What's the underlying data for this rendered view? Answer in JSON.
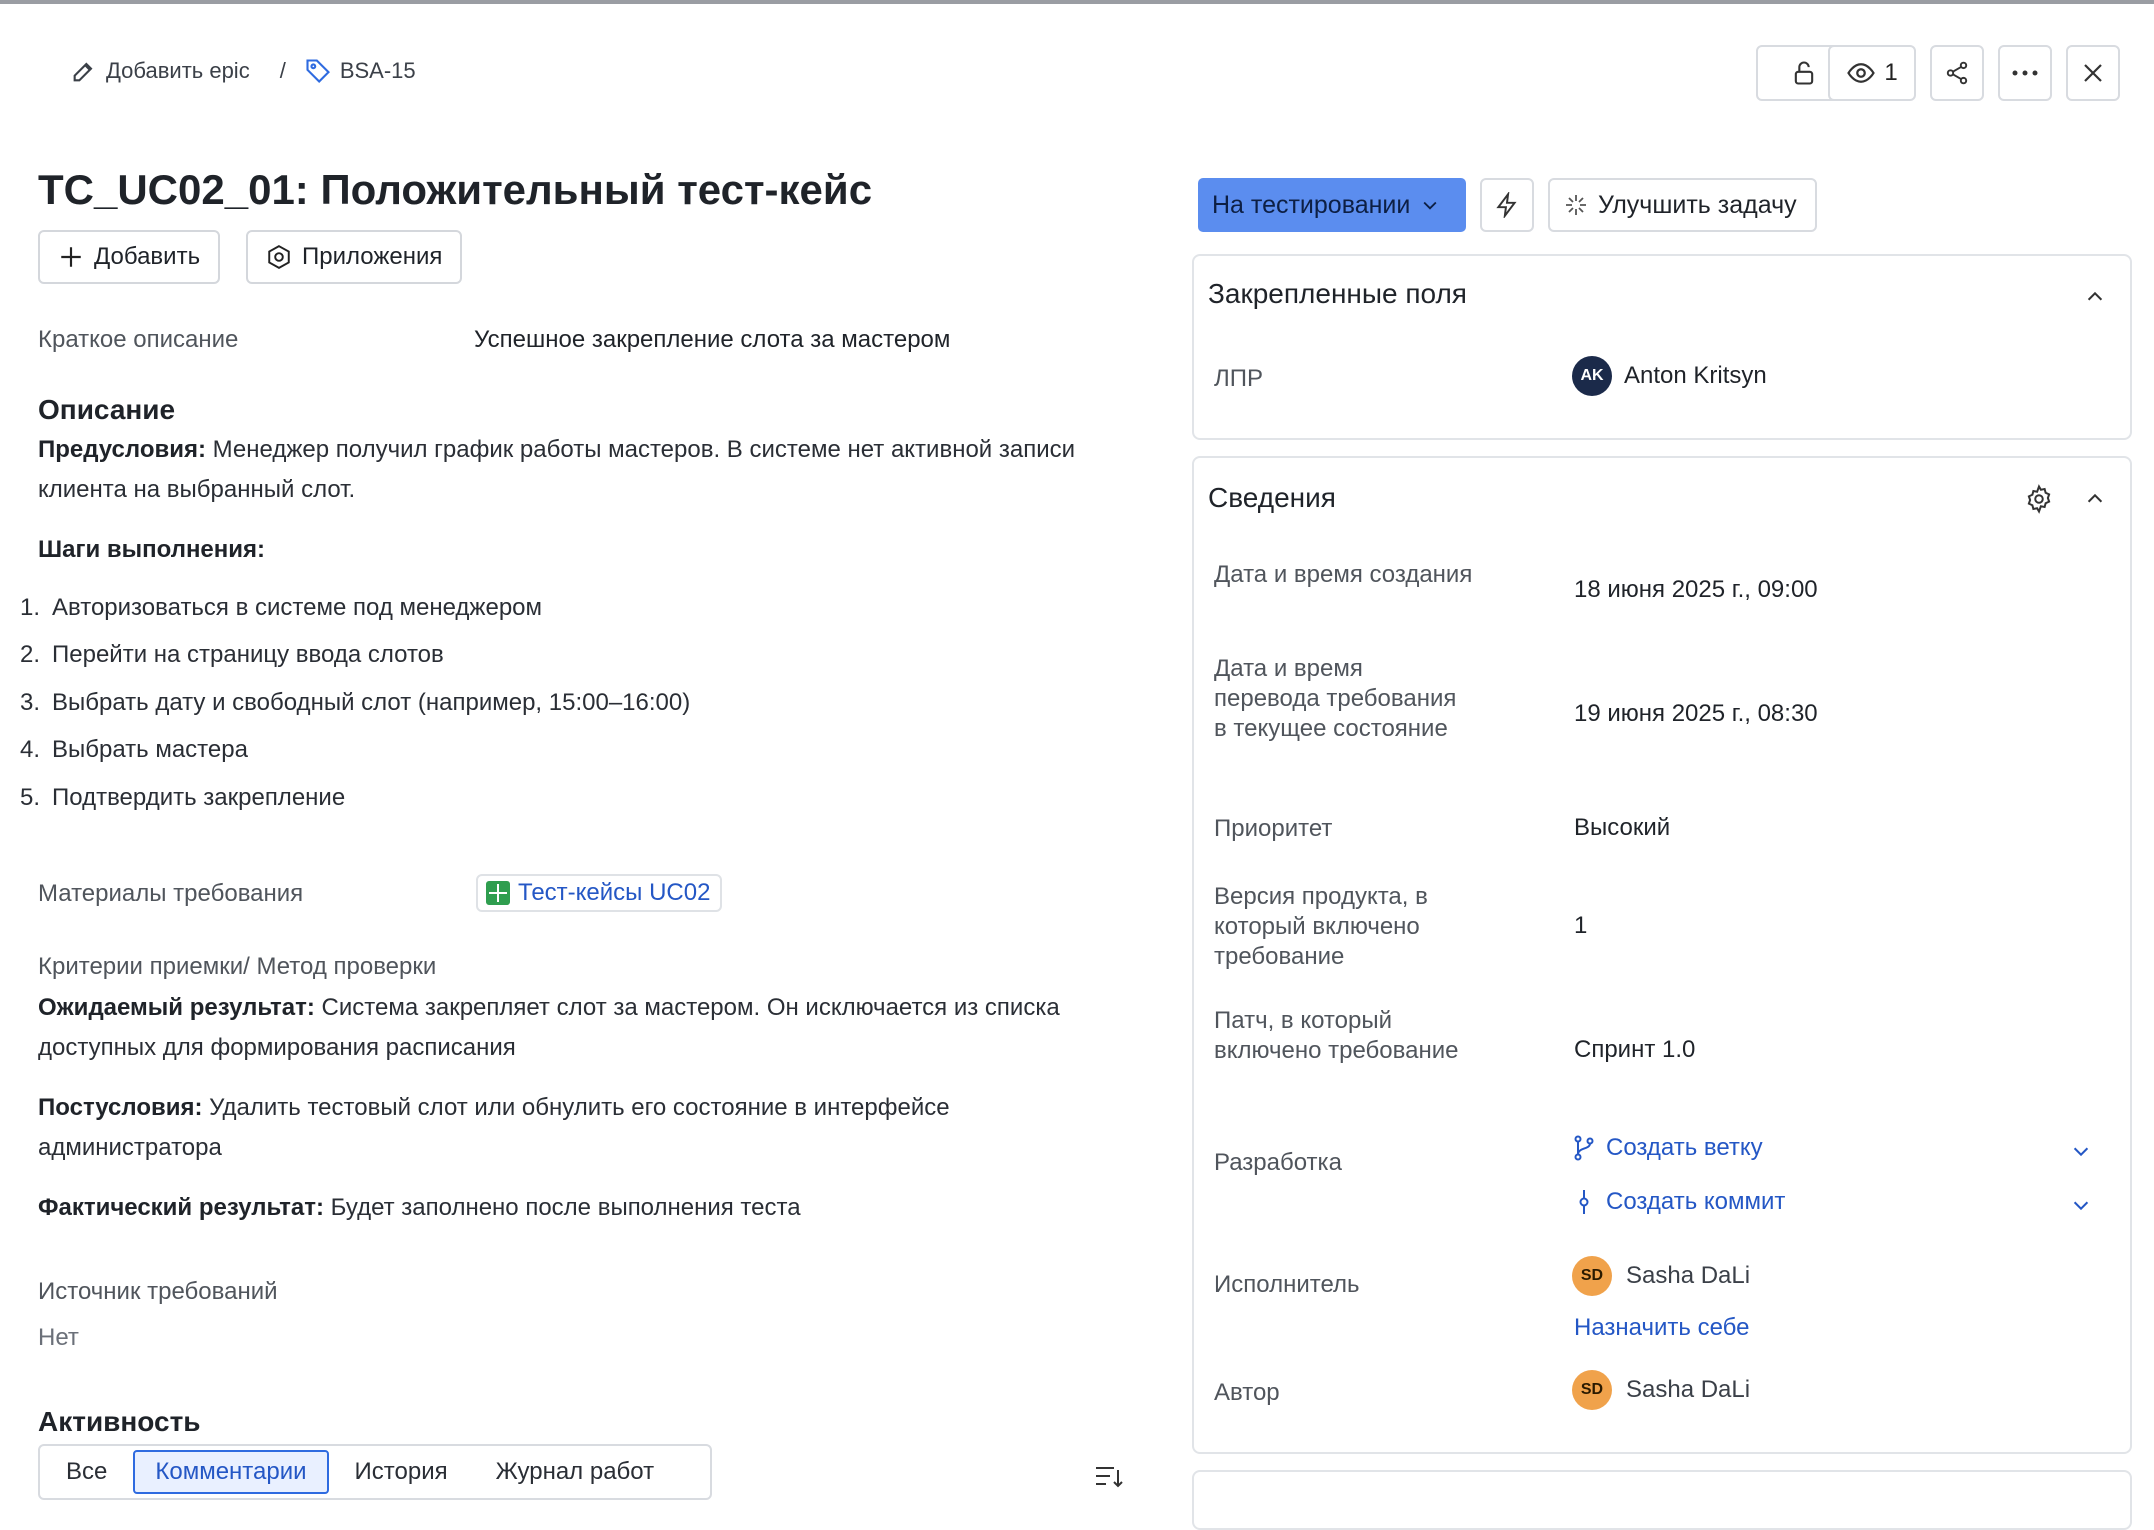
{
  "breadcrumb": {
    "add_epic": "Добавить epic",
    "separator": "/",
    "issue_key": "BSA-15"
  },
  "toolbar": {
    "watchers_count": "1"
  },
  "issue": {
    "title": "TC_UC02_01: Положительный тест-кейс",
    "add_button": "Добавить",
    "apps_button": "Приложения",
    "summary_label": "Краткое описание",
    "summary_value": "Успешное закрепление слота за мастером",
    "description_heading": "Описание",
    "preconditions_label": "Предусловия:",
    "preconditions_text": "Менеджер получил график работы мастеров. В системе нет активной записи клиента на выбранный слот.",
    "steps_heading": "Шаги выполнения:",
    "steps": [
      {
        "num": "1.",
        "text": "Авторизоваться в системе под менеджером"
      },
      {
        "num": "2.",
        "text": "Перейти на страницу ввода слотов"
      },
      {
        "num": "3.",
        "text": "Выбрать дату и свободный слот (например, 15:00–16:00)"
      },
      {
        "num": "4.",
        "text": "Выбрать мастера"
      },
      {
        "num": "5.",
        "text": "Подтвердить закрепление"
      }
    ],
    "materials_label": "Материалы требования",
    "materials_link": "Тест-кейсы UC02",
    "criteria_label": "Критерии приемки/ Метод проверки",
    "expected_label": "Ожидаемый результат:",
    "expected_text": "Система закрепляет слот за мастером. Он исключается из списка доступных для формирования расписания",
    "postconditions_label": "Постусловия:",
    "postconditions_text": "Удалить тестовый слот или обнулить его состояние в интерфейсе администратора",
    "actual_label": "Фактический результат:",
    "actual_text": "Будет заполнено после выполнения теста",
    "source_label": "Источник требований",
    "source_value": "Нет",
    "activity_heading": "Активность",
    "activity_tabs": [
      "Все",
      "Комментарии",
      "История",
      "Журнал работ"
    ],
    "activity_active_tab": "Комментарии"
  },
  "status": {
    "label": "На тестировании",
    "color": "#5b8def",
    "improve_button": "Улучшить задачу"
  },
  "pinned": {
    "title": "Закрепленные поля",
    "lpr_label": "ЛПР",
    "lpr_initials": "AK",
    "lpr_name": "Anton Kritsyn"
  },
  "details": {
    "title": "Сведения",
    "created_label": "Дата и время создания",
    "created_value": "18 июня 2025 г., 09:00",
    "transition_label": "Дата и время перевода требования в текущее состояние",
    "transition_value": "19 июня 2025 г., 08:30",
    "priority_label": "Приоритет",
    "priority_value": "Высокий",
    "version_label": "Версия продукта, в который включено требование",
    "version_value": "1",
    "patch_label": "Патч, в который включено требование",
    "patch_value": "Спринт 1.0",
    "dev_label": "Разработка",
    "create_branch": "Создать ветку",
    "create_commit": "Создать коммит",
    "assignee_label": "Исполнитель",
    "assignee_initials": "SD",
    "assignee_name": "Sasha DaLi",
    "assign_self": "Назначить себе",
    "author_label": "Автор",
    "author_initials": "SD",
    "author_name": "Sasha DaLi"
  }
}
